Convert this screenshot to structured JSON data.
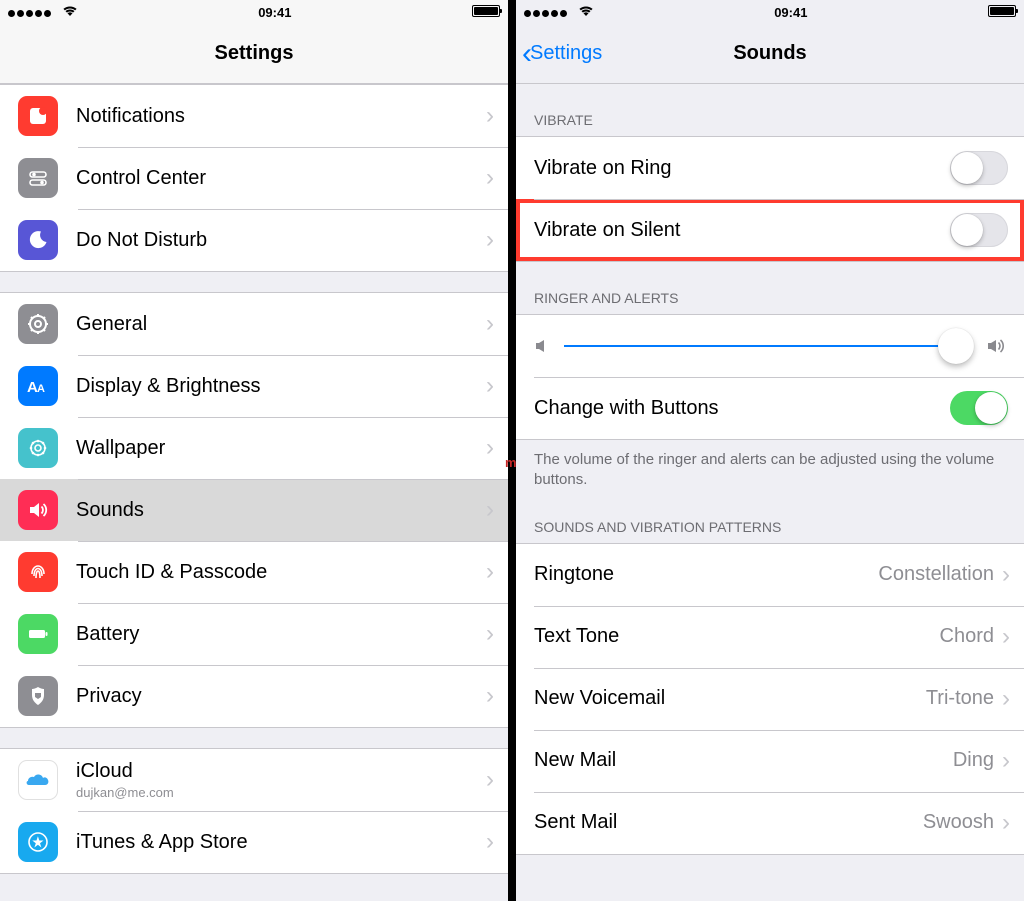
{
  "status": {
    "time": "09:41"
  },
  "left": {
    "title": "Settings",
    "group1": [
      {
        "id": "notifications",
        "label": "Notifications",
        "iconBg": "#ff3b30"
      },
      {
        "id": "control-center",
        "label": "Control Center",
        "iconBg": "#8e8e93"
      },
      {
        "id": "do-not-disturb",
        "label": "Do Not Disturb",
        "iconBg": "#5856d6"
      }
    ],
    "group2": [
      {
        "id": "general",
        "label": "General",
        "iconBg": "#8e8e93"
      },
      {
        "id": "display",
        "label": "Display & Brightness",
        "iconBg": "#007aff"
      },
      {
        "id": "wallpaper",
        "label": "Wallpaper",
        "iconBg": "#45c2cc"
      },
      {
        "id": "sounds",
        "label": "Sounds",
        "iconBg": "#ff2d55",
        "selected": true
      },
      {
        "id": "touchid",
        "label": "Touch ID & Passcode",
        "iconBg": "#ff3b30"
      },
      {
        "id": "battery",
        "label": "Battery",
        "iconBg": "#4cd964"
      },
      {
        "id": "privacy",
        "label": "Privacy",
        "iconBg": "#8e8e93"
      }
    ],
    "group3": [
      {
        "id": "icloud",
        "label": "iCloud",
        "sub": "dujkan@me.com",
        "iconBg": "#ffffff"
      },
      {
        "id": "itunes",
        "label": "iTunes & App Store",
        "iconBg": "#18a9ef"
      }
    ]
  },
  "right": {
    "back": "Settings",
    "title": "Sounds",
    "vibrateHeader": "VIBRATE",
    "vibrate": [
      {
        "id": "vibrate-ring",
        "label": "Vibrate on Ring",
        "on": false,
        "highlight": false
      },
      {
        "id": "vibrate-silent",
        "label": "Vibrate on Silent",
        "on": false,
        "highlight": true
      }
    ],
    "ringerHeader": "RINGER AND ALERTS",
    "changeWithButtons": {
      "label": "Change with Buttons",
      "on": true
    },
    "ringerFooter": "The volume of the ringer and alerts can be adjusted using the volume buttons.",
    "patternsHeader": "SOUNDS AND VIBRATION PATTERNS",
    "patterns": [
      {
        "id": "ringtone",
        "label": "Ringtone",
        "value": "Constellation"
      },
      {
        "id": "texttone",
        "label": "Text Tone",
        "value": "Chord"
      },
      {
        "id": "newvoicemail",
        "label": "New Voicemail",
        "value": "Tri-tone"
      },
      {
        "id": "newmail",
        "label": "New Mail",
        "value": "Ding"
      },
      {
        "id": "sentmail",
        "label": "Sent Mail",
        "value": "Swoosh"
      }
    ]
  },
  "watermark": "m"
}
